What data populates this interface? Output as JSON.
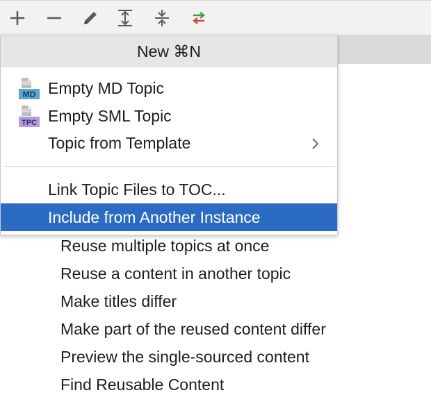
{
  "toolbar": {
    "buttons": [
      {
        "icon": "plus-icon"
      },
      {
        "icon": "minus-icon"
      },
      {
        "icon": "pencil-icon"
      },
      {
        "icon": "expand-all-icon"
      },
      {
        "icon": "collapse-all-icon"
      },
      {
        "icon": "swap-icon"
      }
    ],
    "accent_green": "#3f9a3f",
    "accent_red": "#d9453d"
  },
  "popup": {
    "title": "New ⌘N",
    "items": [
      {
        "label": "Empty MD Topic",
        "icon_badge": "MD",
        "badge_color": "#5ba4d6"
      },
      {
        "label": "Empty SML Topic",
        "icon_badge": "TPC",
        "badge_color": "#9b7bd0"
      },
      {
        "label": "Topic from Template",
        "submenu": true
      },
      {
        "label": "Link Topic Files to TOC..."
      },
      {
        "label": "Include from Another Instance",
        "selected": true
      }
    ],
    "selection_color": "#2c6bc3"
  },
  "background_list": [
    "Reuse multiple topics at once",
    "Reuse a content in another topic",
    "Make titles differ",
    "Make part of the reused content differ",
    "Preview the single-sourced content",
    "Find Reusable Content"
  ]
}
